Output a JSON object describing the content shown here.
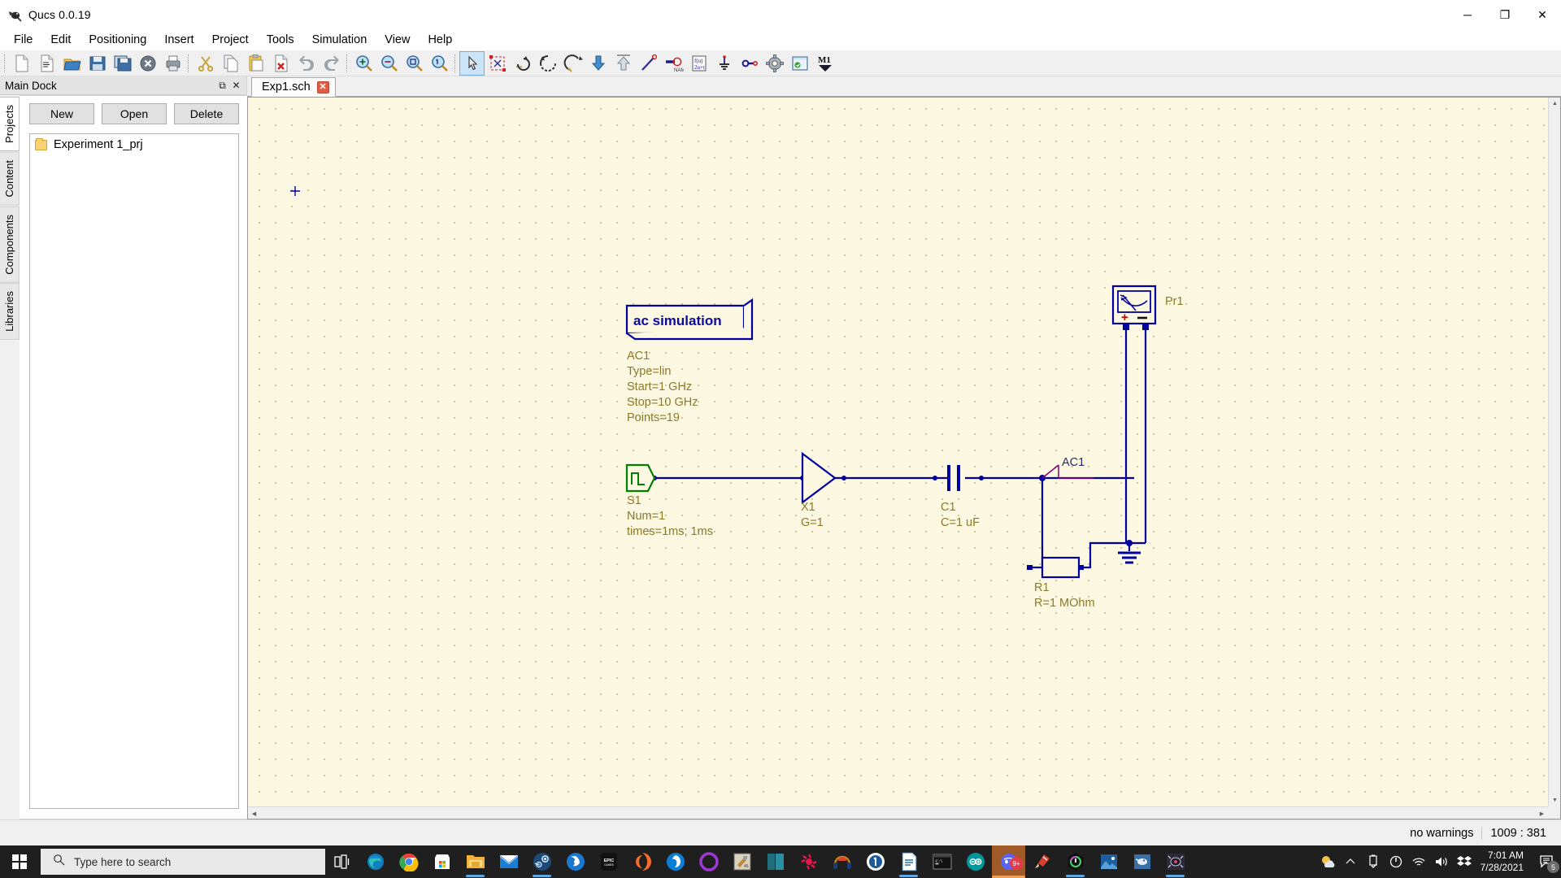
{
  "window": {
    "title": "Qucs 0.0.19",
    "app_icon": "qucs-icon",
    "minimize_label": "─",
    "maximize_label": "❐",
    "close_label": "✕"
  },
  "menubar": {
    "items": [
      {
        "label": "File",
        "name": "menu-file"
      },
      {
        "label": "Edit",
        "name": "menu-edit"
      },
      {
        "label": "Positioning",
        "name": "menu-positioning"
      },
      {
        "label": "Insert",
        "name": "menu-insert"
      },
      {
        "label": "Project",
        "name": "menu-project"
      },
      {
        "label": "Tools",
        "name": "menu-tools"
      },
      {
        "label": "Simulation",
        "name": "menu-simulation"
      },
      {
        "label": "View",
        "name": "menu-view"
      },
      {
        "label": "Help",
        "name": "menu-help"
      }
    ]
  },
  "toolbar": {
    "groups": [
      [
        "new-document-icon",
        "new-text-document-icon",
        "open-folder-icon",
        "save-icon",
        "save-all-icon",
        "close-document-icon",
        "print-icon"
      ],
      [
        "cut-scissors-icon",
        "copy-icon",
        "paste-clipboard-icon",
        "delete-document-icon",
        "undo-arrow-icon",
        "redo-arrow-icon"
      ],
      [
        "zoom-in-icon",
        "zoom-out-icon",
        "zoom-fit-icon",
        "zoom-one-icon"
      ],
      [
        "select-arrow-icon",
        "select-all-markers-icon",
        "rotate-icon",
        "mirror-x-icon",
        "mirror-y-icon",
        "move-down-icon",
        "move-up-icon",
        "wire-line-icon",
        "wire-label-icon",
        "equation-icon",
        "ground-icon",
        "port-icon",
        "simulate-gear-icon",
        "view-dataset-icon",
        "marker-m1-icon"
      ]
    ]
  },
  "dock": {
    "title": "Main Dock",
    "float_label": "⧉",
    "close_label": "✕",
    "tabs": [
      {
        "label": "Projects",
        "selected": true
      },
      {
        "label": "Content",
        "selected": false
      },
      {
        "label": "Components",
        "selected": false
      },
      {
        "label": "Libraries",
        "selected": false
      }
    ],
    "buttons": [
      {
        "label": "New",
        "name": "new-project-button"
      },
      {
        "label": "Open",
        "name": "open-project-button"
      },
      {
        "label": "Delete",
        "name": "delete-project-button"
      }
    ],
    "projects": [
      {
        "label": "Experiment 1_prj",
        "icon": "folder-icon"
      }
    ]
  },
  "editor": {
    "tabs": [
      {
        "label": "Exp1.sch",
        "close_label": "✕",
        "active": true
      }
    ]
  },
  "schematic": {
    "simulation_block": {
      "title": "ac simulation",
      "lines": [
        "AC1",
        "Type=lin",
        "Start=1 GHz",
        "Stop=10 GHz",
        "Points=19"
      ]
    },
    "components": [
      {
        "name": "source",
        "ref": "S1",
        "lines": [
          "S1",
          "Num=1",
          "times=1ms; 1ms"
        ],
        "symbol": "pulse-source-icon"
      },
      {
        "name": "amplifier",
        "ref": "X1",
        "lines": [
          "X1",
          "G=1"
        ],
        "symbol": "amplifier-triangle-icon"
      },
      {
        "name": "capacitor",
        "ref": "C1",
        "lines": [
          "C1",
          "C=1 uF"
        ],
        "symbol": "capacitor-icon"
      },
      {
        "name": "resistor",
        "ref": "R1",
        "lines": [
          "R1",
          "R=1 MOhm"
        ],
        "symbol": "resistor-icon"
      },
      {
        "name": "probe",
        "ref": "Pr1",
        "lines": [
          "Pr1"
        ],
        "symbol": "voltage-probe-icon",
        "plus_label": "+",
        "minus_label": "–"
      }
    ],
    "wire_labels": [
      {
        "label": "AC1",
        "name": "wire-label-ac1"
      }
    ],
    "ground_symbol": "ground-icon",
    "colors": {
      "canvas": "#fdf8e1",
      "wire": "#0000a0",
      "label": "#8a7a2a",
      "node_label": "#800080",
      "sim_title": "#0000c0",
      "source_green": "#008000"
    }
  },
  "statusbar": {
    "warnings": "no warnings",
    "coordinates": "1009 : 381"
  },
  "taskbar": {
    "start_label": "start-icon",
    "search_placeholder": "Type here to search",
    "search_icon": "search-icon",
    "task_view_icon": "task-view-icon",
    "apps": [
      {
        "name": "edge-icon",
        "running": false
      },
      {
        "name": "chrome-icon",
        "running": false
      },
      {
        "name": "microsoft-store-icon",
        "running": false
      },
      {
        "name": "file-explorer-icon",
        "running": true
      },
      {
        "name": "mail-icon",
        "running": false
      },
      {
        "name": "steam-icon",
        "running": true
      },
      {
        "name": "battle-net-icon",
        "running": false
      },
      {
        "name": "epic-games-icon",
        "running": false
      },
      {
        "name": "origin-icon",
        "running": false
      },
      {
        "name": "ubisoft-connect-icon",
        "running": false
      },
      {
        "name": "itch-io-icon",
        "running": false
      },
      {
        "name": "minecraft-icon",
        "running": false
      },
      {
        "name": "obsidian-icon",
        "running": false
      },
      {
        "name": "gog-galaxy-icon",
        "running": false
      },
      {
        "name": "headphones-icon",
        "running": false
      },
      {
        "name": "1password-icon",
        "running": false
      },
      {
        "name": "word-document-icon",
        "running": true
      },
      {
        "name": "terminal-icon",
        "running": false
      },
      {
        "name": "arduino-icon",
        "running": false
      },
      {
        "name": "discord-icon",
        "running": true,
        "active": true,
        "badge": "9+"
      },
      {
        "name": "ccleaner-icon",
        "running": false
      },
      {
        "name": "icue-icon",
        "running": true
      },
      {
        "name": "photos-icon",
        "running": false
      },
      {
        "name": "qucs-icon",
        "running": false
      },
      {
        "name": "game-icon",
        "running": true
      }
    ],
    "tray": {
      "weather_icon": "weather-icon",
      "chevron_icon": "show-hidden-icons-icon",
      "usb_icon": "safely-remove-hardware-icon",
      "power_icon": "power-icon",
      "network_icon": "wifi-icon",
      "volume_icon": "volume-icon",
      "dropbox_icon": "dropbox-icon",
      "time": "7:01 AM",
      "date": "7/28/2021",
      "notification_icon": "notifications-icon",
      "notification_count": "5"
    }
  }
}
